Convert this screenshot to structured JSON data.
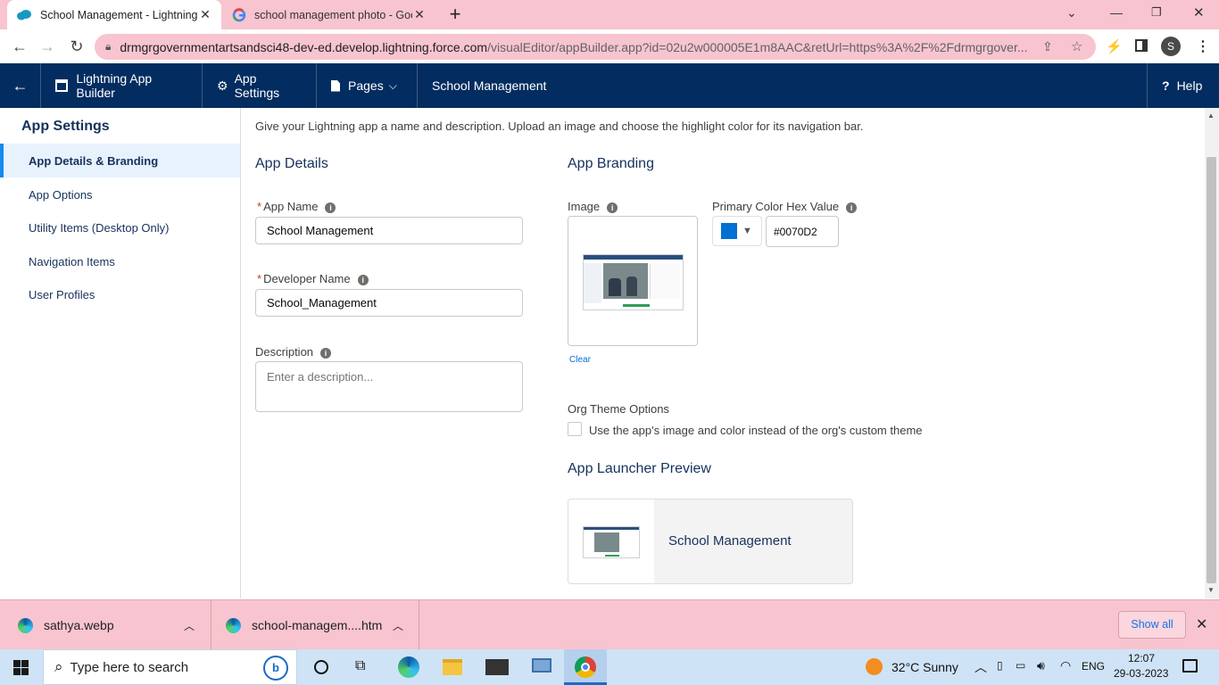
{
  "browser": {
    "tabs": [
      {
        "title": "School Management - Lightning",
        "active": true
      },
      {
        "title": "school management photo - Goo",
        "active": false
      }
    ],
    "url_host": "drmgrgovernmentartsandsci48-dev-ed.develop.lightning.force.com",
    "url_path": "/visualEditor/appBuilder.app?id=02u2w000005E1m8AAC&retUrl=https%3A%2F%2Fdrmgrgover...",
    "profile_initial": "S"
  },
  "header": {
    "app_builder": "Lightning App Builder",
    "app_settings": "App Settings",
    "pages": "Pages",
    "app_name": "School Management",
    "help": "Help"
  },
  "sidebar": {
    "title": "App Settings",
    "items": [
      {
        "label": "App Details & Branding",
        "selected": true
      },
      {
        "label": "App Options"
      },
      {
        "label": "Utility Items (Desktop Only)"
      },
      {
        "label": "Navigation Items"
      },
      {
        "label": "User Profiles"
      }
    ]
  },
  "main": {
    "intro": "Give your Lightning app a name and description. Upload an image and choose the highlight color for its navigation bar.",
    "details_heading": "App Details",
    "app_name_label": "App Name",
    "app_name_value": "School Management",
    "dev_name_label": "Developer Name",
    "dev_name_value": "School_Management",
    "desc_label": "Description",
    "desc_placeholder": "Enter a description...",
    "branding_heading": "App Branding",
    "image_label": "Image",
    "clear_link": "Clear",
    "color_label": "Primary Color Hex Value",
    "color_value": "#0070D2",
    "color_swatch": "#0070D2",
    "org_theme_label": "Org Theme Options",
    "org_theme_checkbox": "Use the app's image and color instead of the org's custom theme",
    "preview_heading": "App Launcher Preview",
    "preview_name": "School Management"
  },
  "downloads": {
    "items": [
      "sathya.webp",
      "school-managem....htm"
    ],
    "show_all": "Show all"
  },
  "taskbar": {
    "search_placeholder": "Type here to search",
    "weather": "32°C  Sunny",
    "lang": "ENG",
    "time": "12:07",
    "date": "29-03-2023"
  }
}
